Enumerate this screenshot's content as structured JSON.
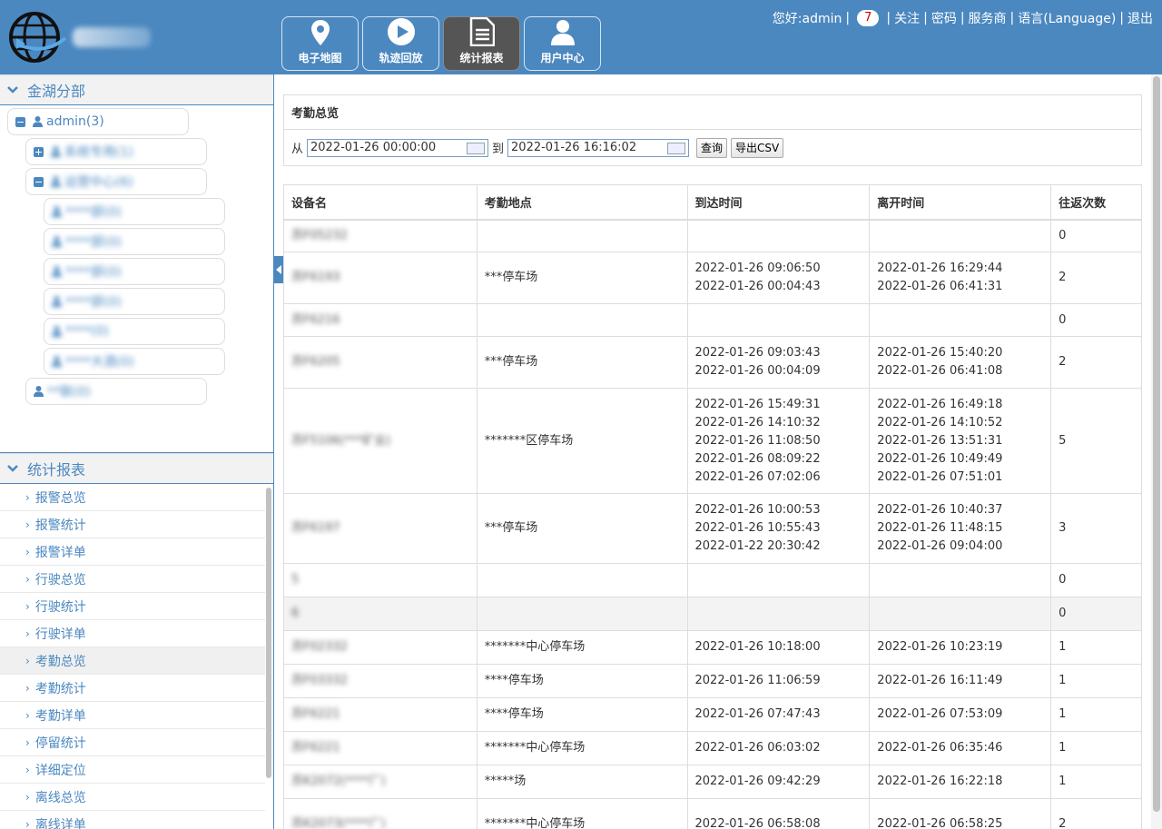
{
  "nav": [
    {
      "label": "电子地图",
      "icon": "map-pin-icon",
      "active": false
    },
    {
      "label": "轨迹回放",
      "icon": "play-icon",
      "active": false
    },
    {
      "label": "统计报表",
      "icon": "document-icon",
      "active": true
    },
    {
      "label": "用户中心",
      "icon": "user-icon",
      "active": false
    }
  ],
  "topbar": {
    "greeting": "您好:admin",
    "badge": "7",
    "links": [
      "关注",
      "密码",
      "服务商",
      "语言(Language)",
      "退出"
    ]
  },
  "org": {
    "title": "金湖分部",
    "nodes": [
      {
        "label": "admin(3)"
      },
      {
        "label": "系统专用(1)"
      },
      {
        "label": "运营中心(6)"
      },
      {
        "label": "****部(0)"
      },
      {
        "label": "****部(0)"
      },
      {
        "label": "****部(0)"
      },
      {
        "label": "****部(0)"
      },
      {
        "label": "****(0)"
      },
      {
        "label": "****大酒(0)"
      },
      {
        "label": "**联(0)"
      }
    ]
  },
  "reports": {
    "title": "统计报表",
    "items": [
      "报警总览",
      "报警统计",
      "报警详单",
      "行驶总览",
      "行驶统计",
      "行驶详单",
      "考勤总览",
      "考勤统计",
      "考勤详单",
      "停留统计",
      "详细定位",
      "离线总览",
      "离线详单"
    ],
    "active_index": 6
  },
  "query": {
    "title": "考勤总览",
    "from_label": "从",
    "to_label": "到",
    "from_value": "2022-01-26 00:00:00",
    "to_value": "2022-01-26 16:16:02",
    "query_btn": "查询",
    "export_btn": "导出CSV"
  },
  "table": {
    "headers": [
      "设备名",
      "考勤地点",
      "到达时间",
      "离开时间",
      "往返次数"
    ],
    "rows": [
      {
        "device": "苏F05232",
        "place": "",
        "arrive": [],
        "leave": [],
        "count": "0"
      },
      {
        "device": "苏F6193",
        "place": "***停车场",
        "arrive": [
          "2022-01-26 09:06:50",
          "2022-01-26 00:04:43"
        ],
        "leave": [
          "2022-01-26 16:29:44",
          "2022-01-26 06:41:31"
        ],
        "count": "2"
      },
      {
        "device": "苏F6216",
        "place": "",
        "arrive": [],
        "leave": [],
        "count": "0"
      },
      {
        "device": "苏F6205",
        "place": "***停车场",
        "arrive": [
          "2022-01-26 09:03:43",
          "2022-01-26 00:04:09"
        ],
        "leave": [
          "2022-01-26 15:40:20",
          "2022-01-26 06:41:08"
        ],
        "count": "2"
      },
      {
        "device": "苏F5106(***矿业)",
        "place": "*******区停车场",
        "arrive": [
          "2022-01-26 15:49:31",
          "2022-01-26 14:10:32",
          "2022-01-26 11:08:50",
          "2022-01-26 08:09:22",
          "2022-01-26 07:02:06"
        ],
        "leave": [
          "2022-01-26 16:49:18",
          "2022-01-26 14:10:52",
          "2022-01-26 13:51:31",
          "2022-01-26 10:49:49",
          "2022-01-26 07:51:01"
        ],
        "count": "5"
      },
      {
        "device": "苏F6197",
        "place": "***停车场",
        "arrive": [
          "2022-01-26 10:00:53",
          "2022-01-26 10:55:43",
          "2022-01-22 20:30:42"
        ],
        "leave": [
          "2022-01-26 10:40:37",
          "2022-01-26 11:48:15",
          "2022-01-26 09:04:00"
        ],
        "count": "3"
      },
      {
        "device": "5",
        "place": "",
        "arrive": [],
        "leave": [],
        "count": "0"
      },
      {
        "device": "6",
        "place": "",
        "arrive": [],
        "leave": [],
        "count": "0"
      },
      {
        "device": "苏F02332",
        "place": "*******中心停车场",
        "arrive": [
          "2022-01-26 10:18:00"
        ],
        "leave": [
          "2022-01-26 10:23:19"
        ],
        "count": "1"
      },
      {
        "device": "苏F03332",
        "place": "****停车场",
        "arrive": [
          "2022-01-26 11:06:59"
        ],
        "leave": [
          "2022-01-26 16:11:49"
        ],
        "count": "1"
      },
      {
        "device": "苏F6221",
        "place": "****停车场",
        "arrive": [
          "2022-01-26 07:47:43"
        ],
        "leave": [
          "2022-01-26 07:53:09"
        ],
        "count": "1"
      },
      {
        "device": "苏F6221",
        "place": "*******中心停车场",
        "arrive": [
          "2022-01-26 06:03:02"
        ],
        "leave": [
          "2022-01-26 06:35:46"
        ],
        "count": "1"
      },
      {
        "device": "苏K2072(****厂)",
        "place": "*****场",
        "arrive": [
          "2022-01-26 09:42:29"
        ],
        "leave": [
          "2022-01-26 16:22:18"
        ],
        "count": "1"
      },
      {
        "device": "苏K2073(****厂)",
        "place": "*******中心停车场",
        "arrive": [
          "2022-01-26 06:58:08"
        ],
        "leave": [
          "2022-01-26 06:58:25"
        ],
        "count": "2"
      }
    ]
  }
}
